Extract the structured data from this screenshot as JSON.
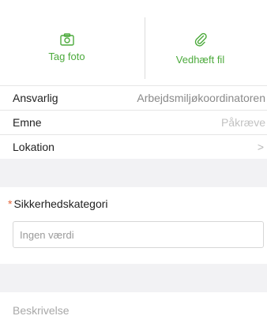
{
  "media": {
    "take_photo_label": "Tag foto",
    "attach_file_label": "Vedhæft fil",
    "accent_color": "#4caa3c"
  },
  "rows": [
    {
      "key": "Ansvarlig",
      "value": "Arbejdsmiljøkoordinatoren"
    },
    {
      "key": "Emne",
      "value": "Påkræve"
    },
    {
      "key": "Lokation",
      "value": ">"
    }
  ],
  "security_category": {
    "label": "Sikkerhedskategori",
    "required_marker": "*",
    "placeholder": "Ingen værdi"
  },
  "description": {
    "label": "Beskrivelse"
  }
}
